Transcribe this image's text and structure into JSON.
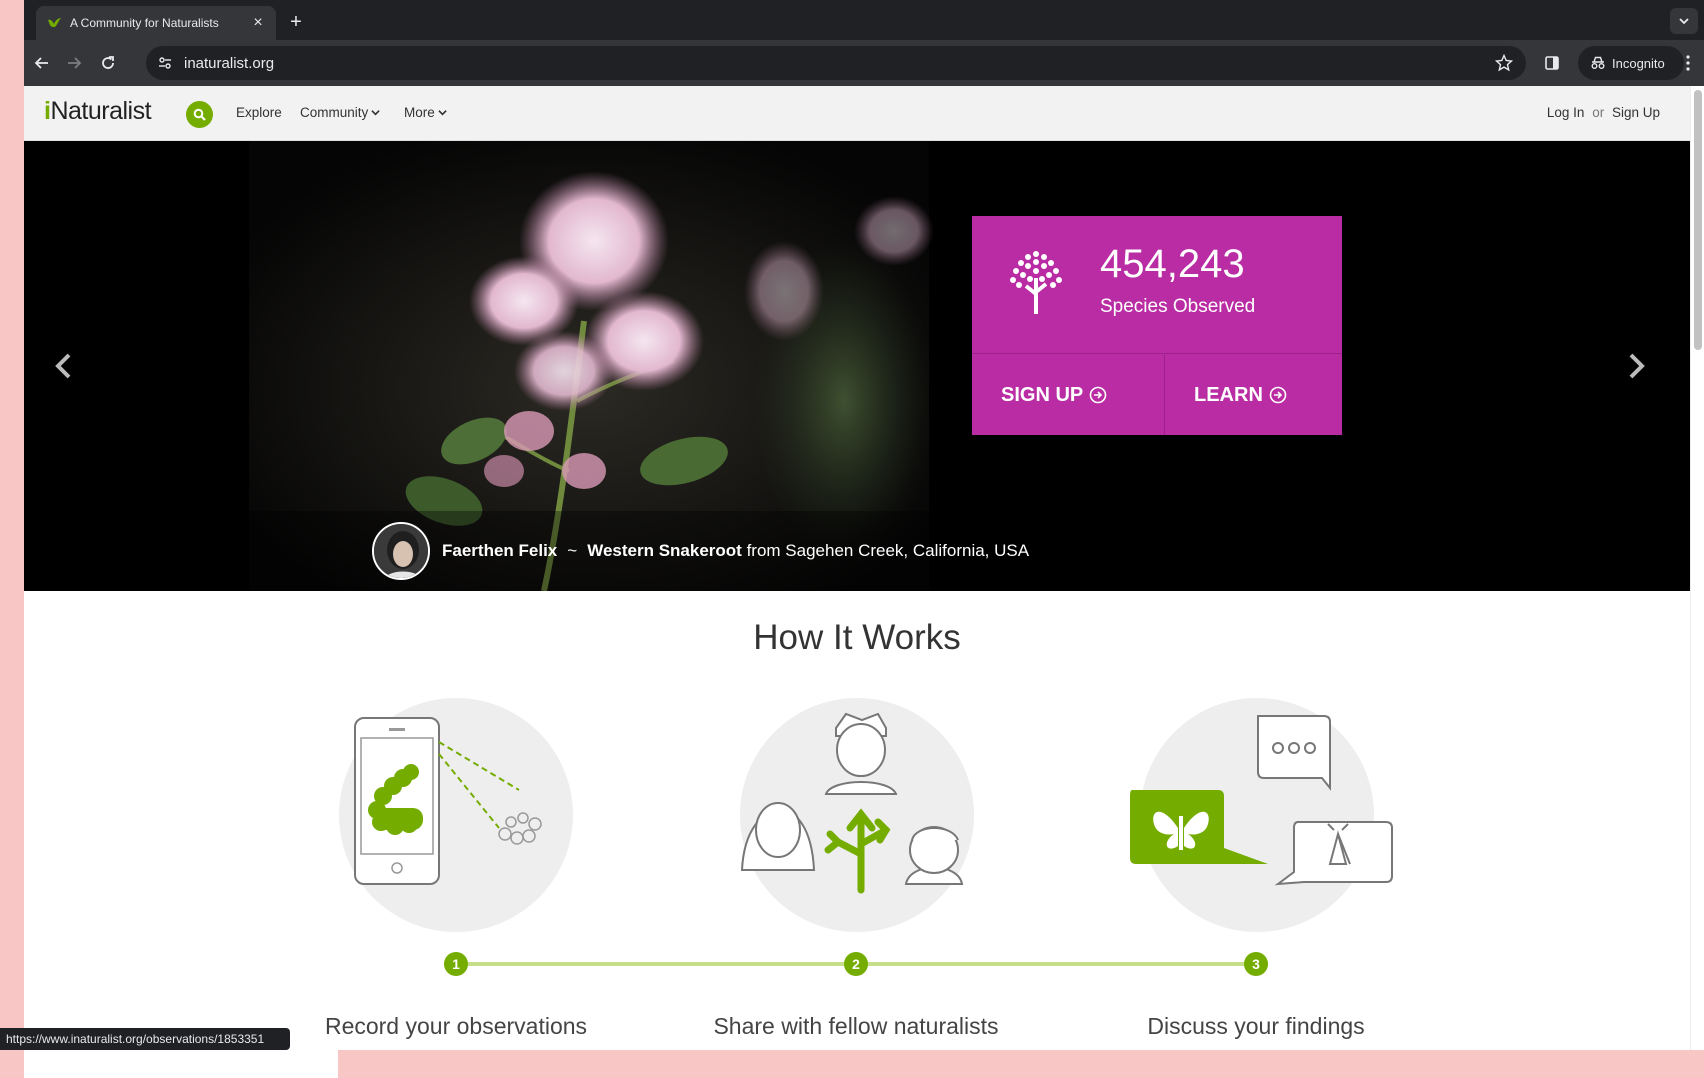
{
  "browser": {
    "tab_title": "A Community for Naturalists",
    "new_tab_symbol": "+",
    "close_symbol": "×",
    "url": "inaturalist.org",
    "incognito_label": "Incognito",
    "status_url": "https://www.inaturalist.org/observations/1853351"
  },
  "site": {
    "logo_i": "i",
    "logo_rest": "Naturalist",
    "nav": {
      "explore": "Explore",
      "community": "Community",
      "more": "More"
    },
    "auth": {
      "login": "Log In",
      "or": "or",
      "signup": "Sign Up"
    }
  },
  "hero": {
    "stat_number": "454,243",
    "stat_label": "Species Observed",
    "signup_button": "SIGN UP",
    "learn_button": "LEARN",
    "credit_user": "Faerthen Felix",
    "credit_sep": "~",
    "credit_species": "Western Snakeroot",
    "credit_location": "from Sagehen Creek, California, USA"
  },
  "how_it_works": {
    "title": "How It Works",
    "steps": [
      {
        "num": "1",
        "label": "Record your observations"
      },
      {
        "num": "2",
        "label": "Share with fellow naturalists"
      },
      {
        "num": "3",
        "label": "Discuss your findings"
      }
    ]
  },
  "colors": {
    "brand_green": "#74ac00",
    "stat_magenta": "#b92ca4"
  },
  "icons": [
    "bird-favicon-icon",
    "back-arrow-icon",
    "forward-arrow-icon",
    "reload-icon",
    "site-info-icon",
    "star-icon",
    "side-panel-icon",
    "incognito-icon",
    "menu-dots-icon",
    "search-icon",
    "tree-icon",
    "circle-arrow-icon",
    "chevron-left-icon",
    "chevron-right-icon"
  ]
}
